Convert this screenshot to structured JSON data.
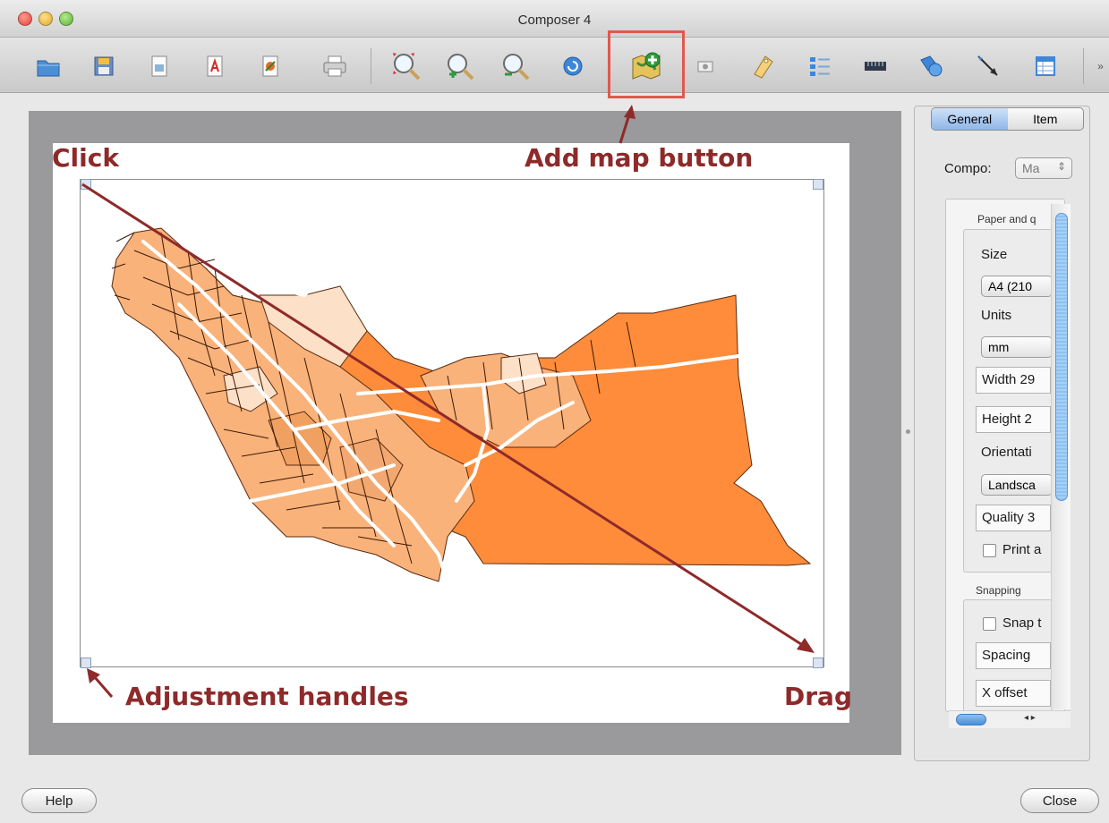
{
  "window": {
    "title": "Composer 4"
  },
  "toolbar": {
    "buttons": [
      {
        "name": "open-template-icon"
      },
      {
        "name": "save-template-icon"
      },
      {
        "name": "export-image-icon"
      },
      {
        "name": "export-pdf-icon"
      },
      {
        "name": "export-svg-icon"
      },
      {
        "name": "print-icon"
      },
      {
        "name": "zoom-full-icon"
      },
      {
        "name": "zoom-in-icon"
      },
      {
        "name": "zoom-out-icon"
      },
      {
        "name": "refresh-icon"
      },
      {
        "name": "add-map-icon"
      },
      {
        "name": "add-image-icon"
      },
      {
        "name": "add-label-icon"
      },
      {
        "name": "add-legend-icon"
      },
      {
        "name": "add-scalebar-icon"
      },
      {
        "name": "add-shape-icon"
      },
      {
        "name": "add-arrow-icon"
      },
      {
        "name": "add-table-icon"
      }
    ]
  },
  "annotations": {
    "click": "Click",
    "add_map": "Add map button",
    "adjustment": "Adjustment handles",
    "drag": "Drag"
  },
  "colors": {
    "annotation": "#8e2a2a",
    "map_dark": "#ff8c3a",
    "map_mid": "#f9b27a",
    "map_light": "#fde0c8",
    "highlight": "#e0584f"
  },
  "panel": {
    "tabs": [
      "General",
      "Item"
    ],
    "compo_label": "Compo:",
    "compo_value": "Ma",
    "paper_group": "Paper and q",
    "size_label": "Size",
    "size_value": "A4 (210",
    "units_label": "Units",
    "units_value": "mm",
    "width": "Width 29",
    "height": "Height 2",
    "orientation_label": "Orientati",
    "orientation_value": "Landsca",
    "quality": "Quality 3",
    "print_as": "Print a",
    "snapping_group": "Snapping",
    "snap_to": "Snap t",
    "spacing": "Spacing",
    "x_offset": "X offset"
  },
  "buttons": {
    "help": "Help",
    "close": "Close"
  }
}
